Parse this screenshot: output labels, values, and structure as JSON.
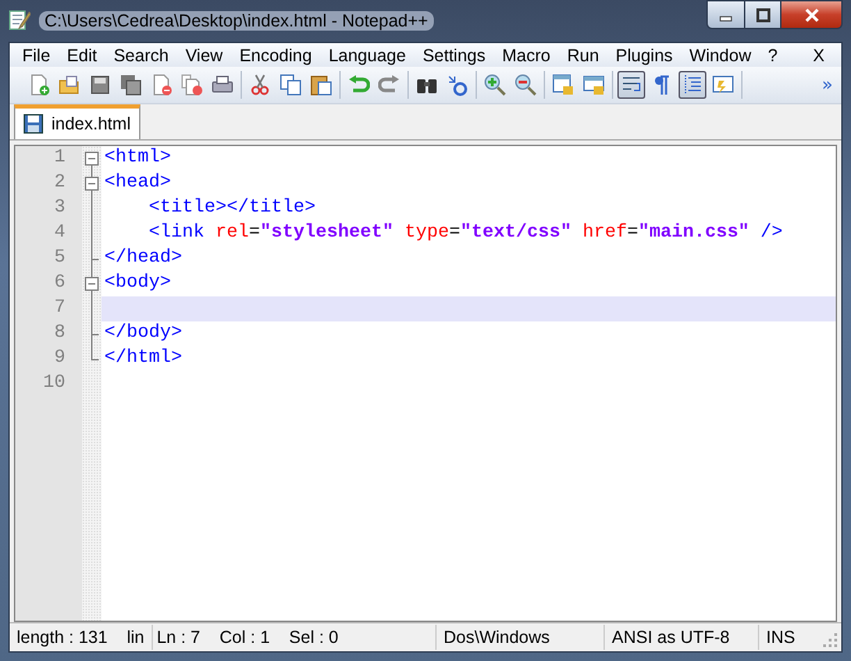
{
  "window": {
    "title": "C:\\Users\\Cedrea\\Desktop\\index.html - Notepad++"
  },
  "menu": [
    "File",
    "Edit",
    "Search",
    "View",
    "Encoding",
    "Language",
    "Settings",
    "Macro",
    "Run",
    "Plugins",
    "Window",
    "?"
  ],
  "menu_close": "X",
  "toolbar": [
    [
      {
        "kind": "new",
        "pressed": false
      },
      {
        "kind": "open",
        "pressed": false
      },
      {
        "kind": "save",
        "pressed": false
      },
      {
        "kind": "save-all",
        "pressed": false
      },
      {
        "kind": "close",
        "pressed": false
      },
      {
        "kind": "close-all",
        "pressed": false
      },
      {
        "kind": "print",
        "pressed": false
      }
    ],
    [
      {
        "kind": "cut",
        "pressed": false
      },
      {
        "kind": "copy",
        "pressed": false
      },
      {
        "kind": "paste",
        "pressed": false
      }
    ],
    [
      {
        "kind": "undo",
        "pressed": false
      },
      {
        "kind": "redo",
        "pressed": false
      }
    ],
    [
      {
        "kind": "find",
        "pressed": false
      },
      {
        "kind": "replace",
        "pressed": false
      }
    ],
    [
      {
        "kind": "zoom-in",
        "pressed": false
      },
      {
        "kind": "zoom-out",
        "pressed": false
      }
    ],
    [
      {
        "kind": "sync-v",
        "pressed": false
      },
      {
        "kind": "sync-h",
        "pressed": false
      }
    ],
    [
      {
        "kind": "wrap",
        "pressed": true
      },
      {
        "kind": "all-chars",
        "pressed": false
      },
      {
        "kind": "indent-guide",
        "pressed": true
      },
      {
        "kind": "udl",
        "pressed": false
      }
    ]
  ],
  "toolbar_more": "»",
  "tabs": [
    {
      "label": "index.html",
      "selected": true
    }
  ],
  "editor": {
    "lines": [
      {
        "number": "1",
        "kind": "fold-open-top",
        "selected": false,
        "tokens": [
          {
            "kind": "tag",
            "text": "<html>"
          }
        ]
      },
      {
        "number": "2",
        "kind": "fold-open",
        "selected": false,
        "tokens": [
          {
            "kind": "tag",
            "text": "<head>"
          }
        ]
      },
      {
        "number": "3",
        "kind": "fold-line",
        "selected": false,
        "tokens": [
          {
            "kind": "tag",
            "text": "    <title></title>"
          }
        ]
      },
      {
        "number": "4",
        "kind": "fold-line",
        "selected": false,
        "tokens": [
          {
            "kind": "tag",
            "text": "    <link"
          },
          {
            "kind": "attr",
            "text": " rel"
          },
          {
            "kind": "eq",
            "text": "="
          },
          {
            "kind": "string",
            "text": "\"stylesheet\""
          },
          {
            "kind": "attr",
            "text": " type"
          },
          {
            "kind": "eq",
            "text": "="
          },
          {
            "kind": "string",
            "text": "\"text/css\""
          },
          {
            "kind": "attr",
            "text": " href"
          },
          {
            "kind": "eq",
            "text": "="
          },
          {
            "kind": "string",
            "text": "\"main.css\""
          },
          {
            "kind": "tag",
            "text": " />"
          }
        ]
      },
      {
        "number": "5",
        "kind": "fold-end",
        "selected": false,
        "tokens": [
          {
            "kind": "tag",
            "text": "</head>"
          }
        ]
      },
      {
        "number": "6",
        "kind": "fold-open",
        "selected": false,
        "tokens": [
          {
            "kind": "tag",
            "text": "<body>"
          }
        ]
      },
      {
        "number": "7",
        "kind": "fold-line",
        "selected": true
      },
      {
        "number": "8",
        "kind": "fold-end",
        "selected": false,
        "tokens": [
          {
            "kind": "tag",
            "text": "</body>"
          }
        ]
      },
      {
        "number": "9",
        "kind": "fold-last",
        "selected": false,
        "tokens": [
          {
            "kind": "tag",
            "text": "</html>"
          }
        ]
      },
      {
        "number": "10",
        "kind": "plain",
        "selected": false
      }
    ]
  },
  "status_bar": [
    "length : 131    lin",
    "Ln : 7    Col : 1    Sel : 0",
    "Dos\\Windows",
    "ANSI as UTF-8",
    "INS"
  ]
}
